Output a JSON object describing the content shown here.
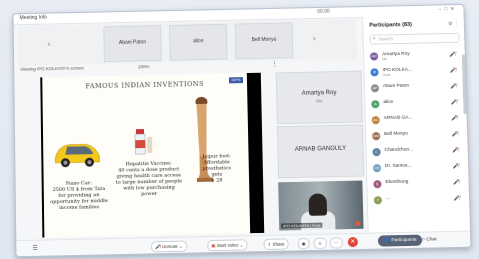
{
  "window": {
    "title": "Meeting Info",
    "timer": "00:00"
  },
  "tiles": [
    {
      "label": "Abani Paton"
    },
    {
      "label": "alice"
    },
    {
      "label": "Bell Monyu"
    }
  ],
  "view": {
    "viewing_label": "Viewing IPO KOLKATA's screen",
    "zoom": "100%"
  },
  "slide": {
    "title": "Famous Indian Inventions",
    "logo": "KIPS",
    "captions": [
      "Nano Car:\n2500 US $ from Tata\nfor providing an\nopportunity for middle\nincome families",
      "Hepatitis Vaccine:\n40 cents a dose product\ngiving health care access\nto large number of people\nwith low purchasing\npower",
      "Jaipur foot:\nAffordable\nprosthetics\ngets\n$ 28"
    ]
  },
  "side_tiles": [
    {
      "name": "Amartya Roy",
      "sub": "Me"
    },
    {
      "name": "ARNAB GANGULY",
      "sub": ""
    }
  ],
  "cam": {
    "tag": "IPO KOLKATA | Host"
  },
  "toolbar": {
    "unmute": "Unmute",
    "start_video": "Start video",
    "share": "Share",
    "participants": "Participants",
    "chat": "Chat"
  },
  "panel": {
    "title": "Participants (83)",
    "search_placeholder": "Search",
    "participants": [
      {
        "name": "Amartya Roy",
        "sub": "Me",
        "initials": "AR",
        "color": "#7a5a9e"
      },
      {
        "name": "IPO KOLKA...",
        "sub": "Host",
        "initials": "IK",
        "color": "#3a7bd5"
      },
      {
        "name": "Abani Paton",
        "sub": "",
        "initials": "AP",
        "color": "#888888"
      },
      {
        "name": "alice",
        "sub": "",
        "initials": "A",
        "color": "#4aa36b"
      },
      {
        "name": "ARNAB GA...",
        "sub": "",
        "initials": "AG",
        "color": "#c0803a"
      },
      {
        "name": "Bell Monyu",
        "sub": "",
        "initials": "BM",
        "color": "#9a6b4e"
      },
      {
        "name": "Chandchun...",
        "sub": "",
        "initials": "C",
        "color": "#5e7fa0"
      },
      {
        "name": "Dr. Santos...",
        "sub": "",
        "initials": "DS",
        "color": "#6aa1b8"
      },
      {
        "name": "Ekonthung",
        "sub": "",
        "initials": "E",
        "color": "#a05a7e"
      },
      {
        "name": "...",
        "sub": "",
        "initials": "?",
        "color": "#8aa05a"
      }
    ]
  },
  "colors": {
    "accent": "#d24a32",
    "end": "#e0463a",
    "participants_btn": "#5a6375"
  }
}
